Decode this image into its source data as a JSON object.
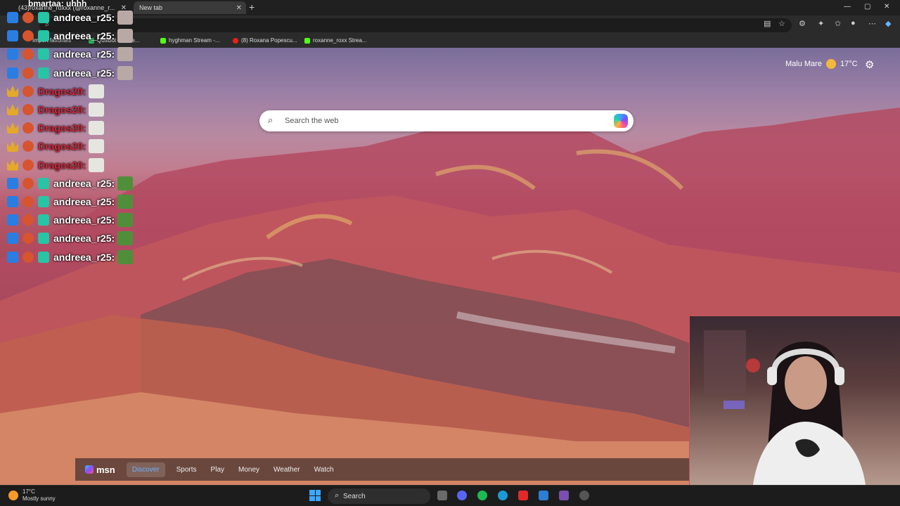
{
  "browser": {
    "tabs": [
      {
        "label": "(43)roxanne_roxxx (@roxanne_r..."
      },
      {
        "label": "New tab"
      }
    ],
    "bookmarks": [
      {
        "label": "Import favorites"
      },
      {
        "label": "Quillbot f...ome..."
      },
      {
        "label": "hyghman Stream -..."
      },
      {
        "label": "(8) Roxana Popescu..."
      },
      {
        "label": "roxanne_roxx Strea..."
      }
    ]
  },
  "chat": {
    "header": "bmartaa: uhhh",
    "messages": [
      {
        "user": "andreea_r25:"
      },
      {
        "user": "andreea_r25:"
      },
      {
        "user": "andreea_r25:"
      },
      {
        "user": "andreea_r25:"
      },
      {
        "user": "Dragos20:"
      },
      {
        "user": "Dragos20:"
      },
      {
        "user": "Dragos20:"
      },
      {
        "user": "Dragos20:"
      },
      {
        "user": "Dragos20:"
      },
      {
        "user": "andreea_r25:"
      },
      {
        "user": "andreea_r25:"
      },
      {
        "user": "andreea_r25:"
      },
      {
        "user": "andreea_r25:"
      },
      {
        "user": "andreea_r25:"
      }
    ]
  },
  "weather": {
    "location": "Malu Mare",
    "temp": "17°C"
  },
  "search": {
    "placeholder": "Search the web"
  },
  "msn": {
    "logo": "msn",
    "tabs": [
      {
        "label": "Discover"
      },
      {
        "label": "Sports"
      },
      {
        "label": "Play"
      },
      {
        "label": "Money"
      },
      {
        "label": "Weather"
      },
      {
        "label": "Watch"
      }
    ]
  },
  "taskbar": {
    "weather_temp": "17°C",
    "weather_desc": "Mostly sunny",
    "search_label": "Search"
  }
}
